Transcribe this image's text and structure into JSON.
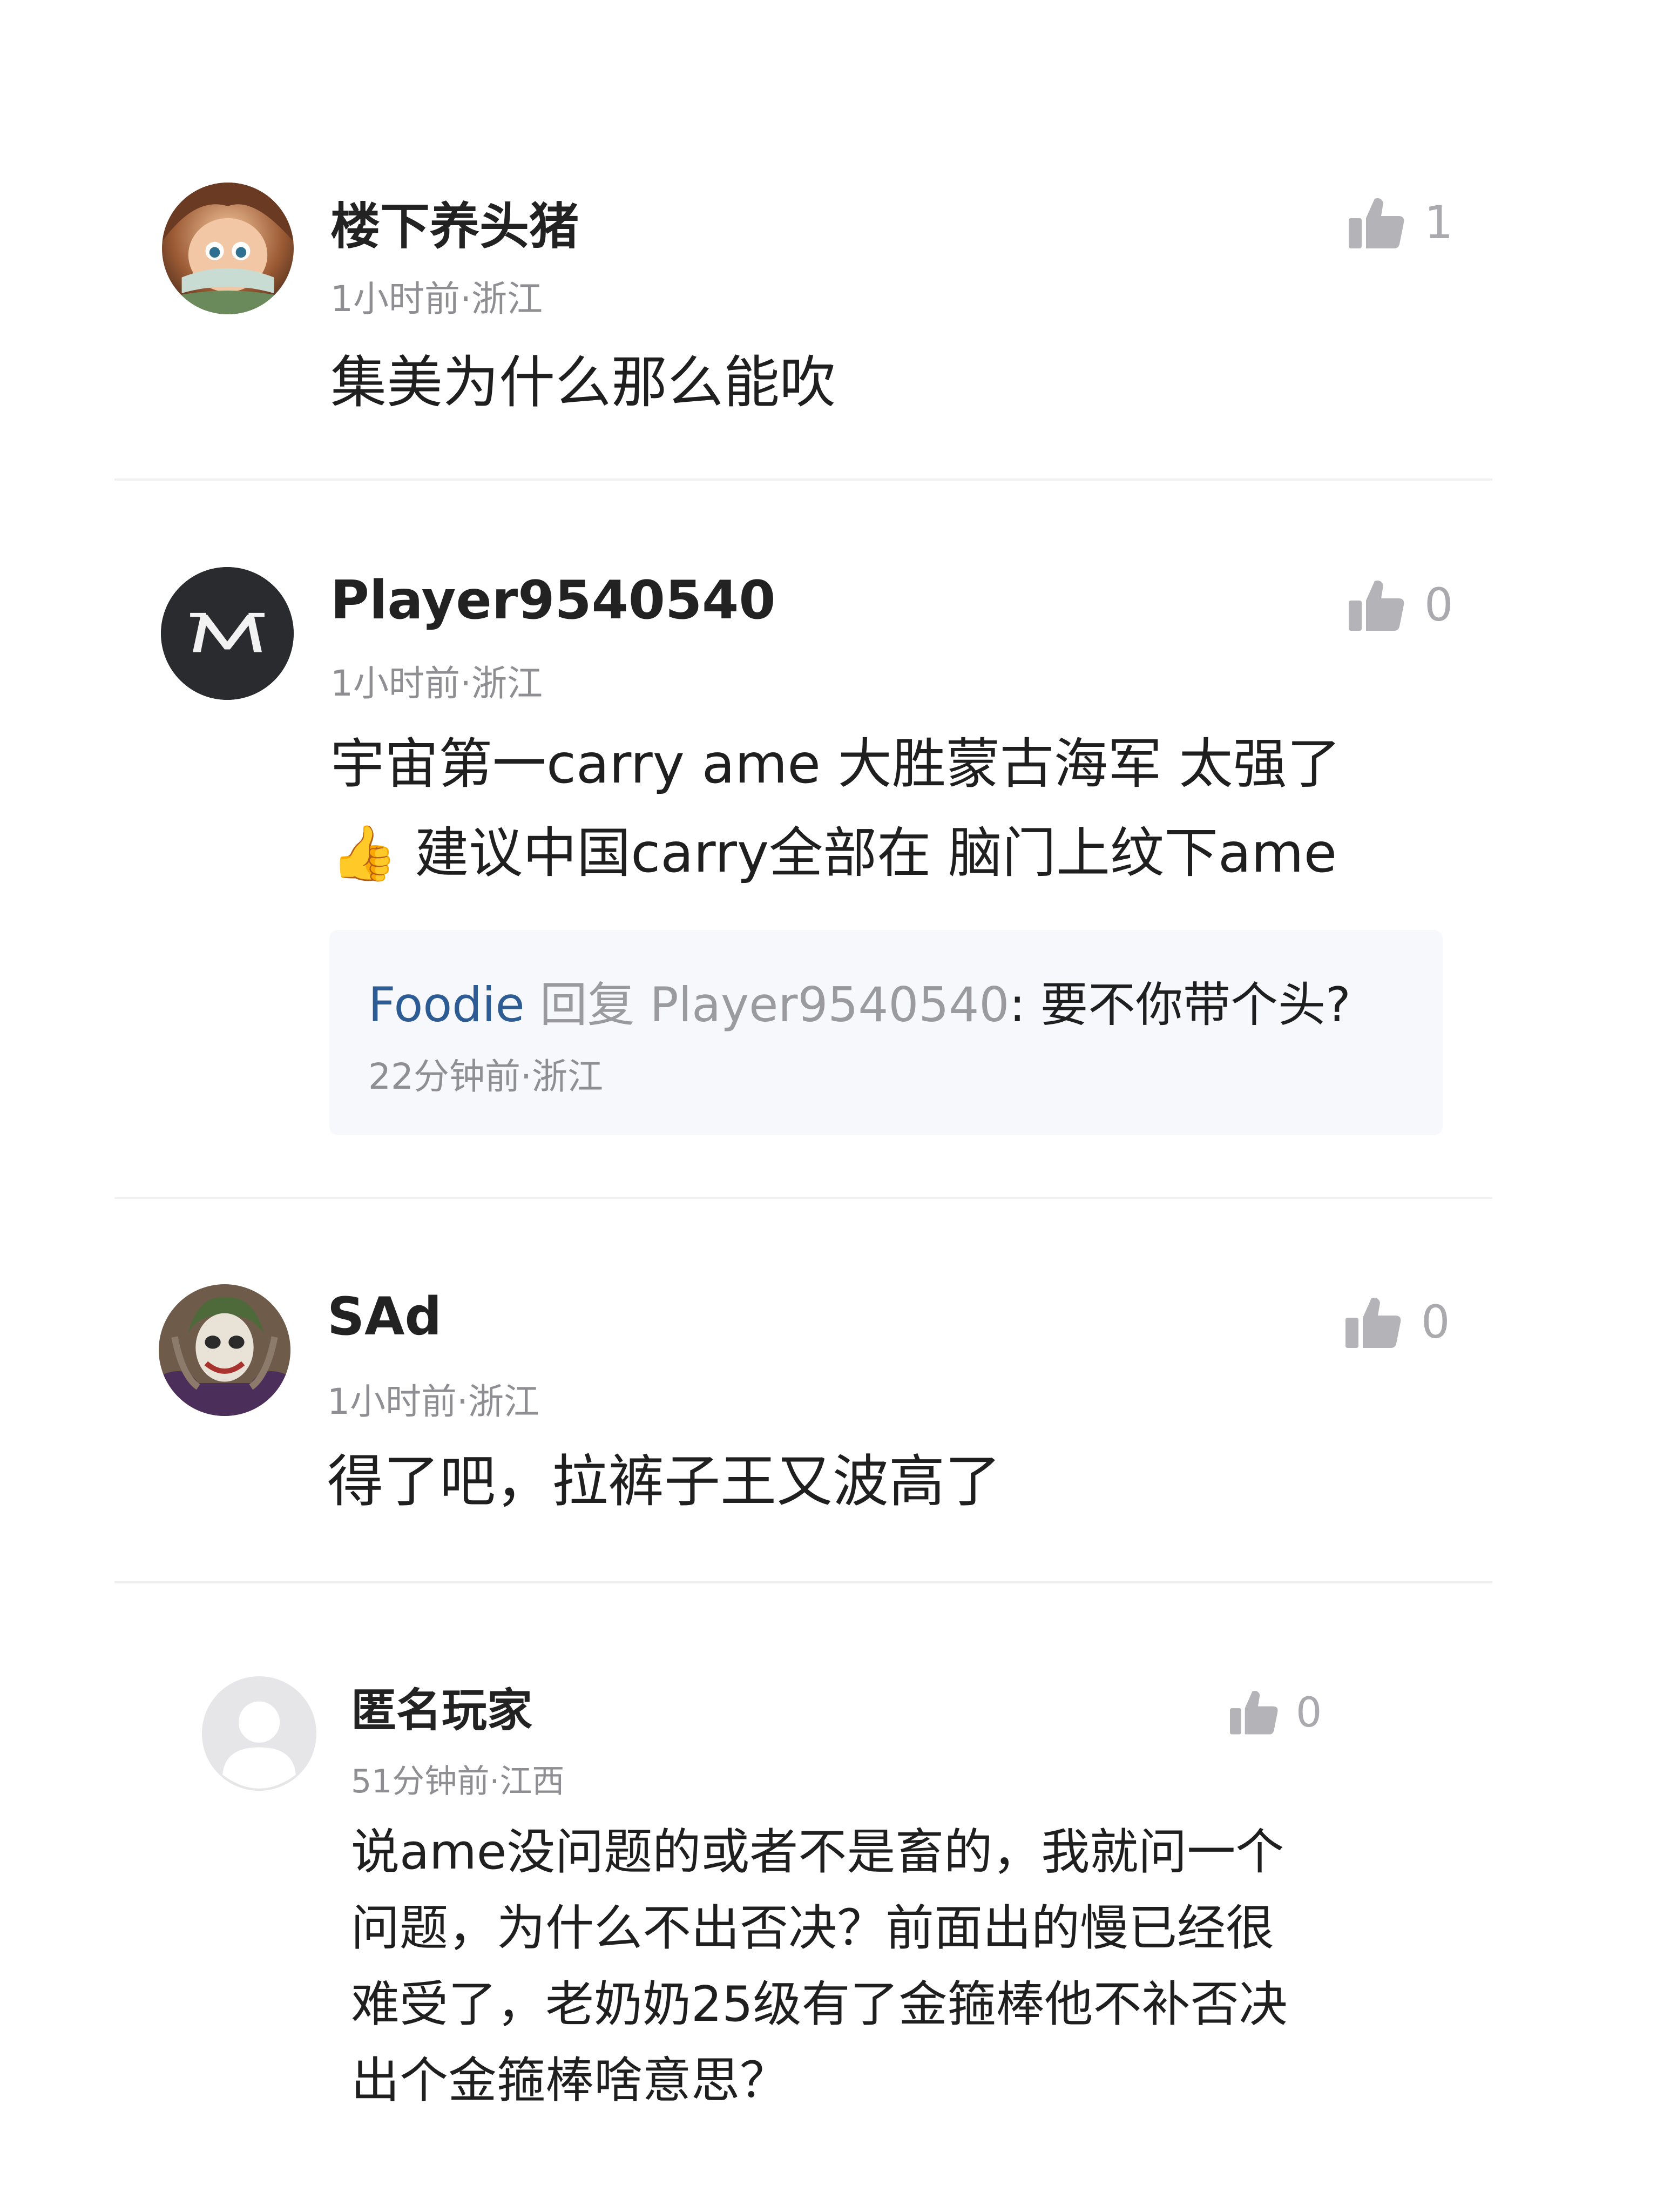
{
  "comments": [
    {
      "username": "楼下养头猪",
      "meta": "1小时前·浙江",
      "likes": "1",
      "text": "集美为什么那么能吹"
    },
    {
      "username": "Player9540540",
      "meta": "1小时前·浙江",
      "likes": "0",
      "text_line1": "宇宙第一carry ame 大胜蒙古海军 太强了",
      "text_line2": "👍 建议中国carry全部在 脑门上纹下ame",
      "reply": {
        "author": "Foodie",
        "verb": "回复",
        "target": "Player9540540",
        "text": ": 要不你带个头?",
        "meta": "22分钟前·浙江"
      }
    },
    {
      "username": "SAd",
      "meta": "1小时前·浙江",
      "likes": "0",
      "text": "得了吧，拉裤子王又波高了"
    },
    {
      "username": "匿名玩家",
      "meta": "51分钟前·江西",
      "likes": "0",
      "text_lines": [
        "说ame没问题的或者不是畜的，我就问一个",
        "问题，为什么不出否决？前面出的慢已经很",
        "难受了，老奶奶25级有了金箍棒他不补否决",
        "出个金箍棒啥意思？"
      ]
    }
  ],
  "colors": {
    "reply_author": "#2d5c94",
    "meta_gray": "#8e8e93",
    "like_gray": "#a9a9ae",
    "reply_bg": "#f6f8fb",
    "divider": "#f0f0f2"
  },
  "icons": {
    "like": "thumbs-up-icon",
    "avatar_1": "cartoon-girl-avatar",
    "avatar_2": "m-logo-avatar",
    "avatar_3": "joker-avatar",
    "avatar_4": "default-user-avatar"
  }
}
